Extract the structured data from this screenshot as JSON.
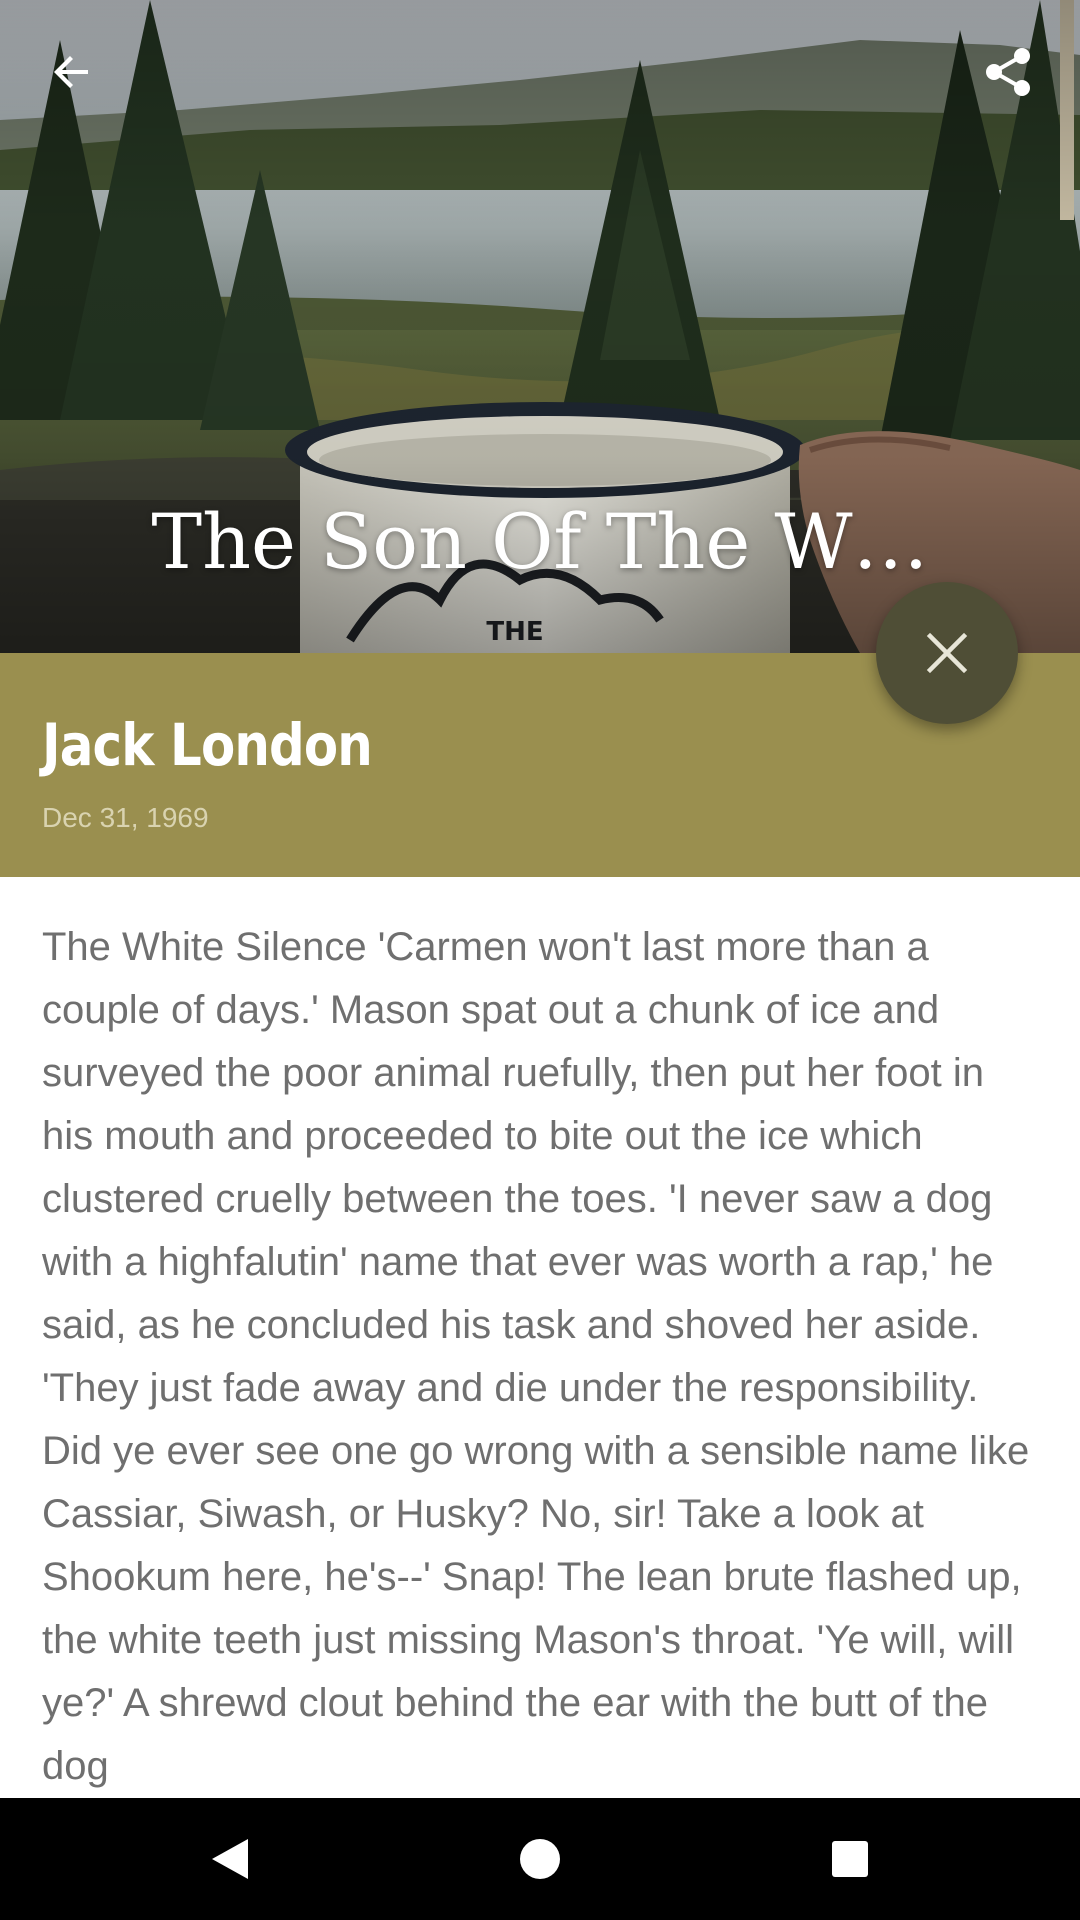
{
  "app": {
    "accent_color": "#9a8f4f",
    "fab_color": "#4f4e36"
  },
  "toolbar": {
    "back_icon": "arrow-left-icon",
    "share_icon": "share-icon"
  },
  "hero": {
    "title": "The Son Of The W…",
    "image_description_icon": "cover-photo"
  },
  "article": {
    "author": "Jack London",
    "date": "Dec 31, 1969",
    "fab_icon": "close-icon",
    "body": "The White Silence 'Carmen won't last more than a couple of days.' Mason spat out a chunk of ice and surveyed the poor animal ruefully, then put her foot in his mouth and proceeded to bite out the ice which clustered cruelly between the toes. 'I never saw a dog with a highfalutin' name that ever was worth a rap,' he said, as he concluded his task and shoved her aside. 'They just fade away and die under the responsibility. Did ye ever see one go wrong with a sensible name like Cassiar, Siwash, or Husky? No, sir! Take a look at Shookum here, he's--' Snap! The lean brute flashed up, the white teeth just missing Mason's throat. 'Ye will, will ye?' A shrewd clout behind the ear with the butt of the dog"
  },
  "system_nav": {
    "back_icon": "nav-back-triangle-icon",
    "home_icon": "nav-home-circle-icon",
    "recents_icon": "nav-recents-square-icon"
  }
}
